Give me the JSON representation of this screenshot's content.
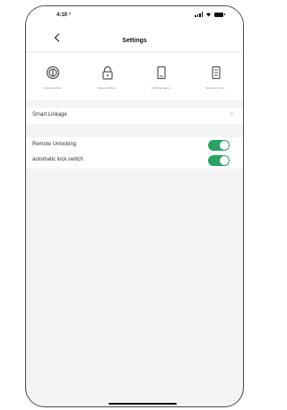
{
  "status": {
    "time": "4:10 ⁷"
  },
  "nav": {
    "title": "Settings"
  },
  "tools": [
    {
      "icon": "fingerprint-icon",
      "label": "Fingerprint Ma..."
    },
    {
      "icon": "lock-icon",
      "label": "Password Man..."
    },
    {
      "icon": "card-icon",
      "label": "Card Managem..."
    },
    {
      "icon": "temporary-password-icon",
      "label": "Temporary Pas..."
    }
  ],
  "smart_linkage": {
    "label": "Smart Linkage",
    "chevron": ">"
  },
  "toggles": [
    {
      "label": "Remote Unlocking",
      "on": true
    },
    {
      "label": "automatic lock switch",
      "on": true
    }
  ],
  "colors": {
    "accent": "#27a364",
    "background": "#f4f4f4"
  }
}
